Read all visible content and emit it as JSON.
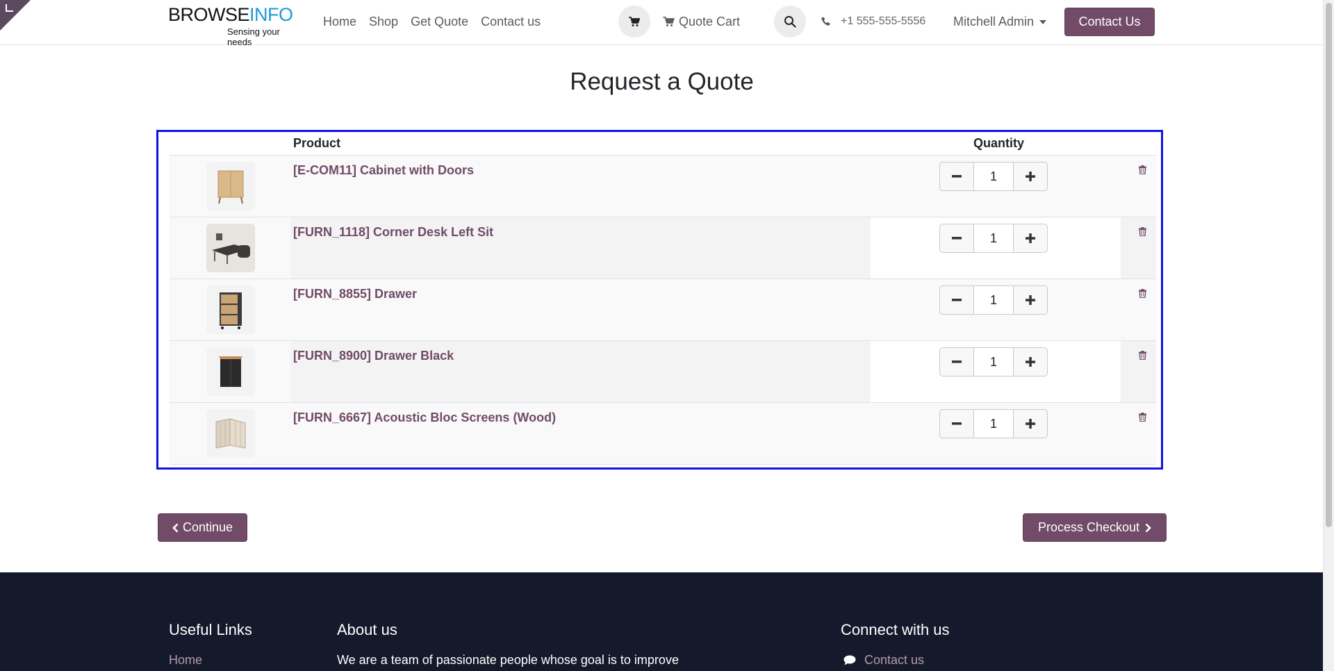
{
  "header": {
    "logo_brand": "BROWSE",
    "logo_brand_accent": "INFO",
    "logo_tagline": "Sensing your needs",
    "nav": [
      "Home",
      "Shop",
      "Get Quote",
      "Contact us"
    ],
    "quote_cart_label": "Quote Cart",
    "phone": "+1 555-555-5556",
    "user_name": "Mitchell Admin",
    "contact_button": "Contact Us"
  },
  "page": {
    "title": "Request a Quote"
  },
  "table": {
    "headers": {
      "product": "Product",
      "quantity": "Quantity"
    },
    "rows": [
      {
        "name": "[E-COM11] Cabinet with Doors",
        "qty": "1",
        "image": "cabinet"
      },
      {
        "name": "[FURN_1118] Corner Desk Left Sit",
        "qty": "1",
        "image": "corner-desk"
      },
      {
        "name": "[FURN_8855] Drawer",
        "qty": "1",
        "image": "drawer"
      },
      {
        "name": "[FURN_8900] Drawer Black",
        "qty": "1",
        "image": "drawer-black"
      },
      {
        "name": "[FURN_6667] Acoustic Bloc Screens (Wood)",
        "qty": "1",
        "image": "acoustic-screens"
      }
    ]
  },
  "actions": {
    "continue": "Continue",
    "checkout": "Process Checkout"
  },
  "footer": {
    "useful_links_title": "Useful Links",
    "useful_links_first": "Home",
    "about_title": "About us",
    "about_text": "We are a team of passionate people whose goal is to improve",
    "connect_title": "Connect with us",
    "connect_first": "Contact us"
  },
  "colors": {
    "brand": "#714b67",
    "selection_border": "#1010e6",
    "footer_bg": "#141a2b"
  }
}
